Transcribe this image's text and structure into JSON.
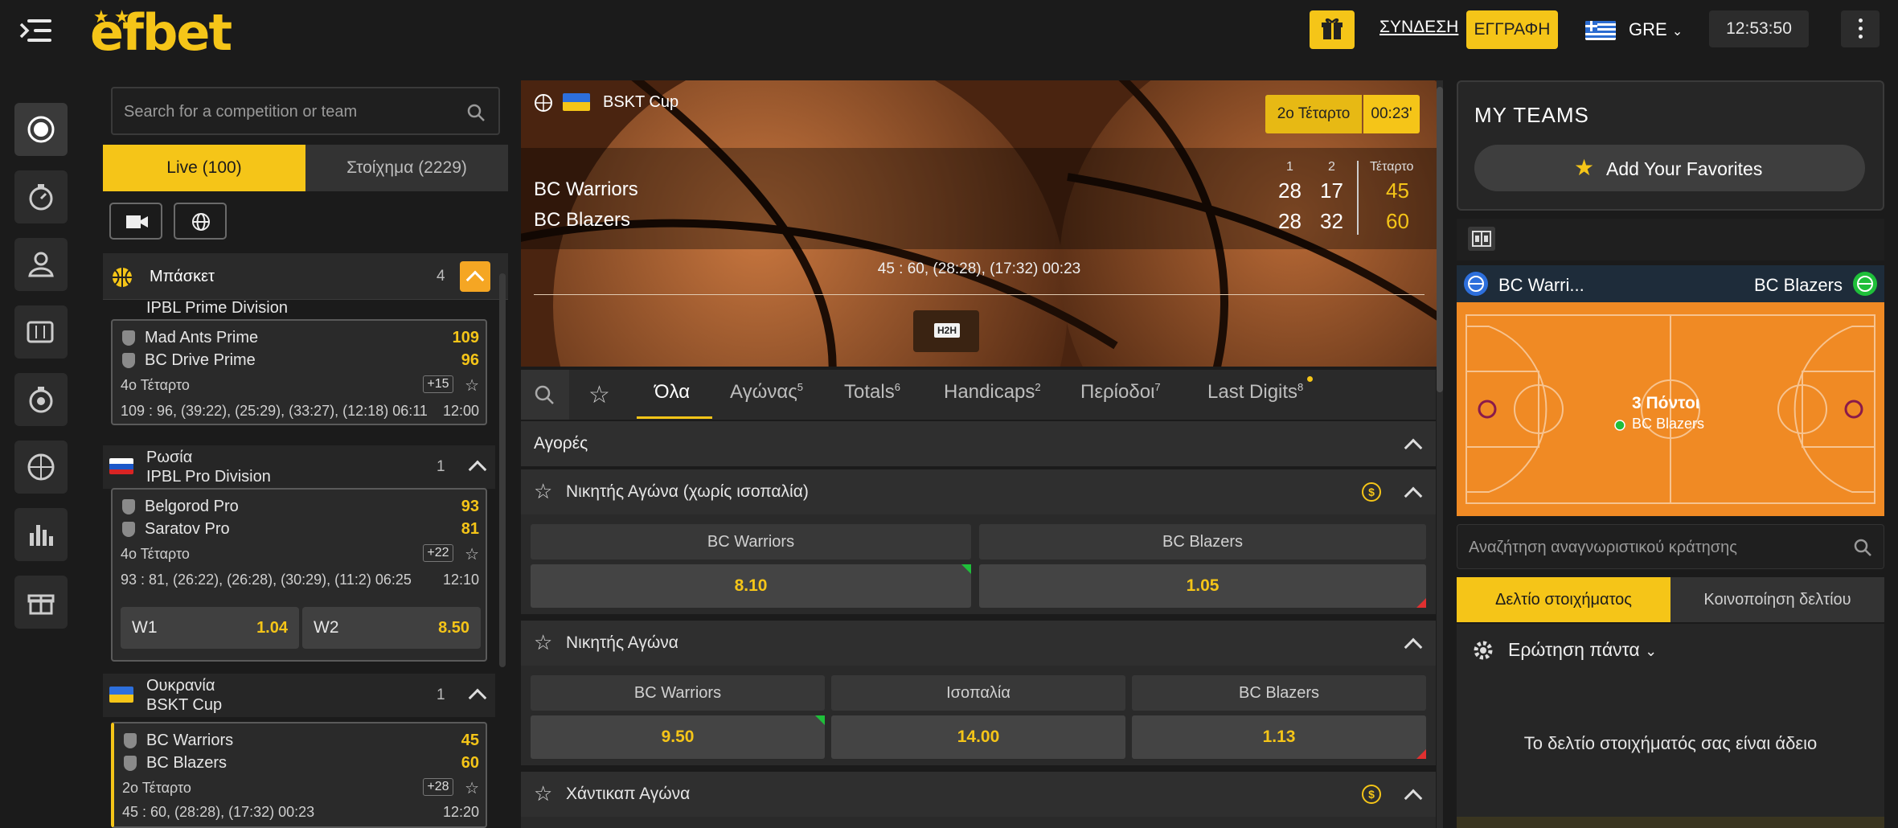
{
  "brand": {
    "logo_text": "efbet"
  },
  "header": {
    "login": "ΣΥΝΔΕΣΗ",
    "register": "ΕΓΓΡΑΦΗ",
    "language": "GRE",
    "time": "12:53:50"
  },
  "left": {
    "search_placeholder": "Search for a competition or team",
    "tab_live": "Live (100)",
    "tab_prematch": "Στοίχημα (2229)",
    "sport": {
      "name": "Μπάσκετ",
      "count": "4"
    },
    "partial_league": "IPBL Prime Division",
    "matches": [
      {
        "team1": "Mad Ants Prime",
        "team2": "BC Drive Prime",
        "score1": "109",
        "score2": "96",
        "period": "4ο Τέταρτο",
        "markets": "+15",
        "detail": "109 : 96, (39:22), (25:29), (33:27), (12:18) 06:11",
        "start": "12:00"
      },
      {
        "team1": "Belgorod Pro",
        "team2": "Saratov Pro",
        "score1": "93",
        "score2": "81",
        "period": "4ο Τέταρτο",
        "markets": "+22",
        "detail": "93 : 81, (26:22), (26:28), (30:29), (11:2) 06:25",
        "start": "12:10"
      },
      {
        "team1": "BC Warriors",
        "team2": "BC Blazers",
        "score1": "45",
        "score2": "60",
        "period": "2ο Τέταρτο",
        "markets": "+28",
        "detail": "45 : 60, (28:28), (17:32) 00:23",
        "start": "12:20"
      }
    ],
    "leagues": [
      {
        "country": "Ρωσία",
        "name": "IPBL Pro Division",
        "count": "1"
      },
      {
        "country": "Ουκρανία",
        "name": "BSKT Cup",
        "count": "1"
      }
    ],
    "odds": [
      {
        "k": "W1",
        "v": "1.04"
      },
      {
        "k": "W2",
        "v": "8.50"
      }
    ]
  },
  "hero": {
    "competition": "BSKT Cup",
    "period": "2ο Τέταρτο",
    "timer": "00:23'",
    "col1": "1",
    "col2": "2",
    "col_period": "Τέταρτο",
    "home": "BC Warriors",
    "away": "BC Blazers",
    "home_q1": "28",
    "home_q2": "17",
    "home_total": "45",
    "away_q1": "28",
    "away_q2": "32",
    "away_total": "60",
    "summary": "45 : 60, (28:28), (17:32) 00:23",
    "h2h": "H2H"
  },
  "market_tabs": [
    {
      "label": "Όλα",
      "count": ""
    },
    {
      "label": "Αγώνας",
      "count": "5"
    },
    {
      "label": "Totals",
      "count": "6"
    },
    {
      "label": "Handicaps",
      "count": "2"
    },
    {
      "label": "Περίοδοι",
      "count": "7"
    },
    {
      "label": "Last Digits",
      "count": "8"
    }
  ],
  "markets": {
    "section_title": "Αγορές",
    "m1": {
      "title": "Νικητής Αγώνα (χωρίς ισοπαλία)",
      "h1": "BC Warriors",
      "h2": "BC Blazers",
      "v1": "8.10",
      "v2": "1.05"
    },
    "m2": {
      "title": "Νικητής Αγώνα",
      "h1": "BC Warriors",
      "h2": "Ισοπαλία",
      "h3": "BC Blazers",
      "v1": "9.50",
      "v2": "14.00",
      "v3": "1.13"
    },
    "m3": {
      "title": "Χάντικαπ Αγώνα"
    }
  },
  "right": {
    "my_teams": "MY TEAMS",
    "add_favorites": "Add Your Favorites",
    "tracker_home": "BC Warri...",
    "tracker_away": "BC Blazers",
    "court_event": "3 Πόντοι",
    "court_team": "BC Blazers",
    "ticket_search_placeholder": "Αναζήτηση αναγνωριστικού κράτησης",
    "tab_slip": "Δελτίο στοιχήματος",
    "tab_share": "Κοινοποίηση δελτίου",
    "question": "Ερώτηση πάντα",
    "empty": "Το δελτίο στοιχήματός σας είναι άδειο"
  },
  "colors": {
    "accent": "#f5c518",
    "bg": "#1b1b1b",
    "panel": "#2a2a2a",
    "court": "#f08a24"
  }
}
